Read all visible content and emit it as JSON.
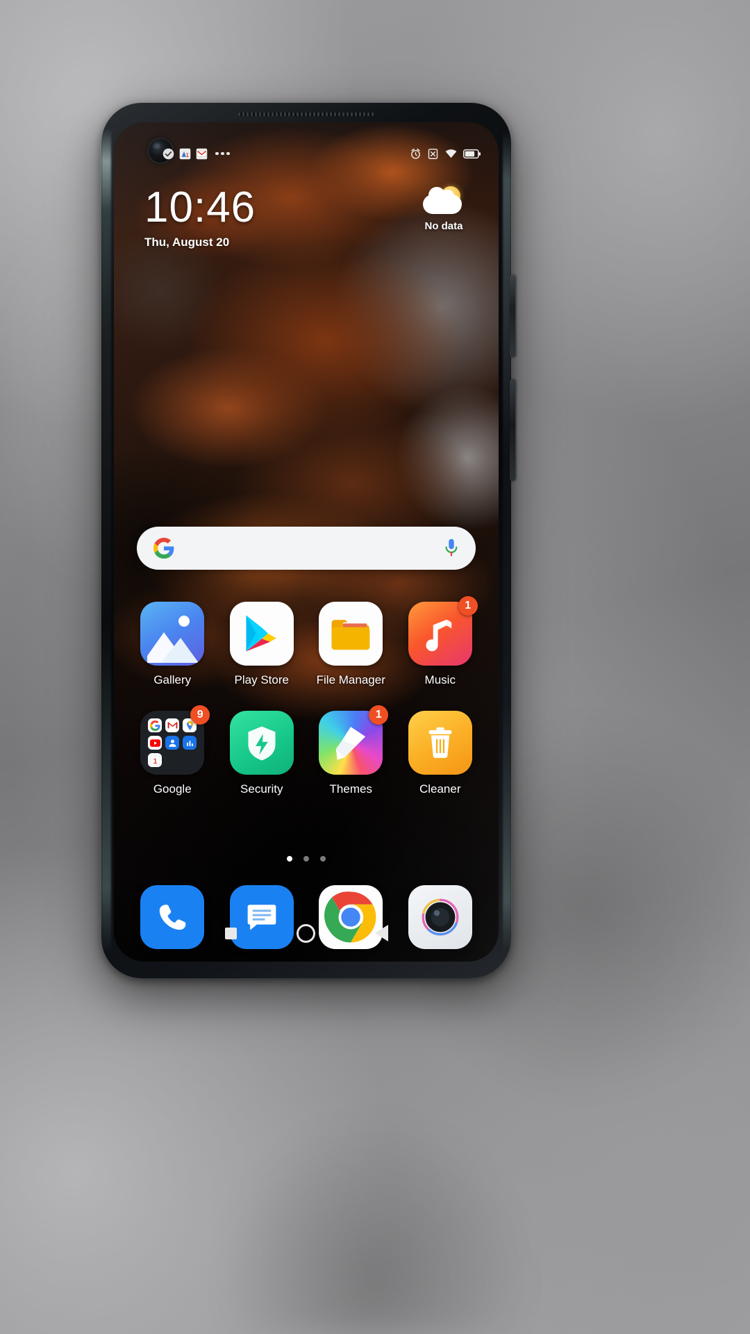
{
  "device": {
    "platform": "MIUI Android home screen",
    "accent_color": "#1a81f2",
    "badge_color": "#f04e23"
  },
  "status_bar": {
    "left_icons": [
      "check-circle-icon",
      "app-notification-icon",
      "gmail-icon",
      "more-notifications-icon"
    ],
    "right_icons": [
      "alarm-icon",
      "no-sim-icon",
      "wifi-icon",
      "battery-icon"
    ],
    "overflow_label": "•••"
  },
  "clock_widget": {
    "time": "10:46",
    "date": "Thu, August 20"
  },
  "weather_widget": {
    "icon": "sun-behind-cloud-icon",
    "status": "No data"
  },
  "search": {
    "placeholder": "",
    "value": "",
    "left_icon": "google-g-icon",
    "right_icon": "microphone-icon"
  },
  "app_rows": [
    [
      {
        "label": "Gallery",
        "icon": "gallery-icon",
        "badge": ""
      },
      {
        "label": "Play Store",
        "icon": "play-store-icon",
        "badge": ""
      },
      {
        "label": "File Manager",
        "icon": "file-manager-icon",
        "badge": ""
      },
      {
        "label": "Music",
        "icon": "music-icon",
        "badge": "1"
      }
    ],
    [
      {
        "label": "Google",
        "icon": "google-folder-icon",
        "badge": "9"
      },
      {
        "label": "Security",
        "icon": "security-icon",
        "badge": ""
      },
      {
        "label": "Themes",
        "icon": "themes-icon",
        "badge": "1"
      },
      {
        "label": "Cleaner",
        "icon": "cleaner-icon",
        "badge": ""
      }
    ]
  ],
  "google_folder_apps": [
    "google-search-icon",
    "gmail-icon",
    "maps-icon",
    "youtube-icon",
    "contacts-icon",
    "drive-icon",
    "calendar-icon"
  ],
  "calendar_day": "1",
  "page_indicator": {
    "count": 3,
    "active_index": 0
  },
  "dock": [
    {
      "label": "Phone",
      "icon": "phone-icon"
    },
    {
      "label": "Messages",
      "icon": "messages-icon"
    },
    {
      "label": "Chrome",
      "icon": "chrome-icon"
    },
    {
      "label": "Camera",
      "icon": "camera-icon"
    }
  ],
  "nav_bar": [
    {
      "label": "Recents",
      "icon": "recents-square-icon"
    },
    {
      "label": "Home",
      "icon": "home-circle-icon"
    },
    {
      "label": "Back",
      "icon": "back-triangle-icon"
    }
  ]
}
